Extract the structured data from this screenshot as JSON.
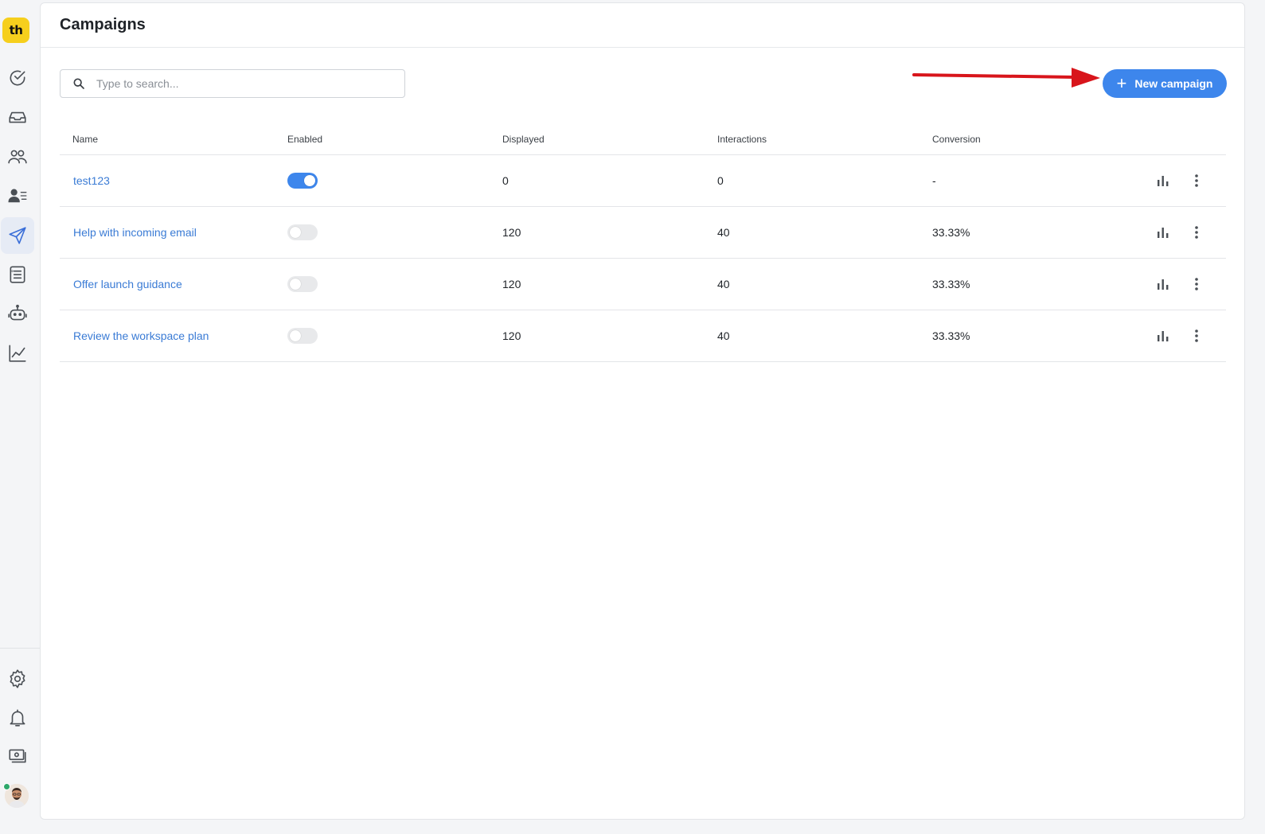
{
  "sidebar": {
    "logo_text": "th",
    "items": [
      {
        "name": "tasks",
        "icon": "check-circle-icon"
      },
      {
        "name": "inbox",
        "icon": "inbox-icon"
      },
      {
        "name": "visitors",
        "icon": "users-icon"
      },
      {
        "name": "contacts",
        "icon": "contacts-icon"
      },
      {
        "name": "campaigns",
        "icon": "send-icon",
        "active": true
      },
      {
        "name": "knowledge",
        "icon": "list-icon"
      },
      {
        "name": "bots",
        "icon": "robot-icon"
      },
      {
        "name": "analytics",
        "icon": "chart-line-icon"
      }
    ],
    "bottom_items": [
      {
        "name": "settings",
        "icon": "gear-icon"
      },
      {
        "name": "notifications",
        "icon": "bell-icon"
      },
      {
        "name": "billing",
        "icon": "money-icon"
      }
    ],
    "status_color": "#2ea86b"
  },
  "header": {
    "title": "Campaigns"
  },
  "toolbar": {
    "search_placeholder": "Type to search...",
    "new_campaign_label": "New campaign",
    "accent_color": "#3d86ec"
  },
  "table": {
    "columns": [
      "Name",
      "Enabled",
      "Displayed",
      "Interactions",
      "Conversion"
    ],
    "rows": [
      {
        "name": "test123",
        "enabled": true,
        "displayed": "0",
        "interactions": "0",
        "conversion": "-"
      },
      {
        "name": "Help with incoming email",
        "enabled": false,
        "displayed": "120",
        "interactions": "40",
        "conversion": "33.33%"
      },
      {
        "name": "Offer launch guidance",
        "enabled": false,
        "displayed": "120",
        "interactions": "40",
        "conversion": "33.33%"
      },
      {
        "name": "Review the workspace plan",
        "enabled": false,
        "displayed": "120",
        "interactions": "40",
        "conversion": "33.33%"
      }
    ]
  }
}
